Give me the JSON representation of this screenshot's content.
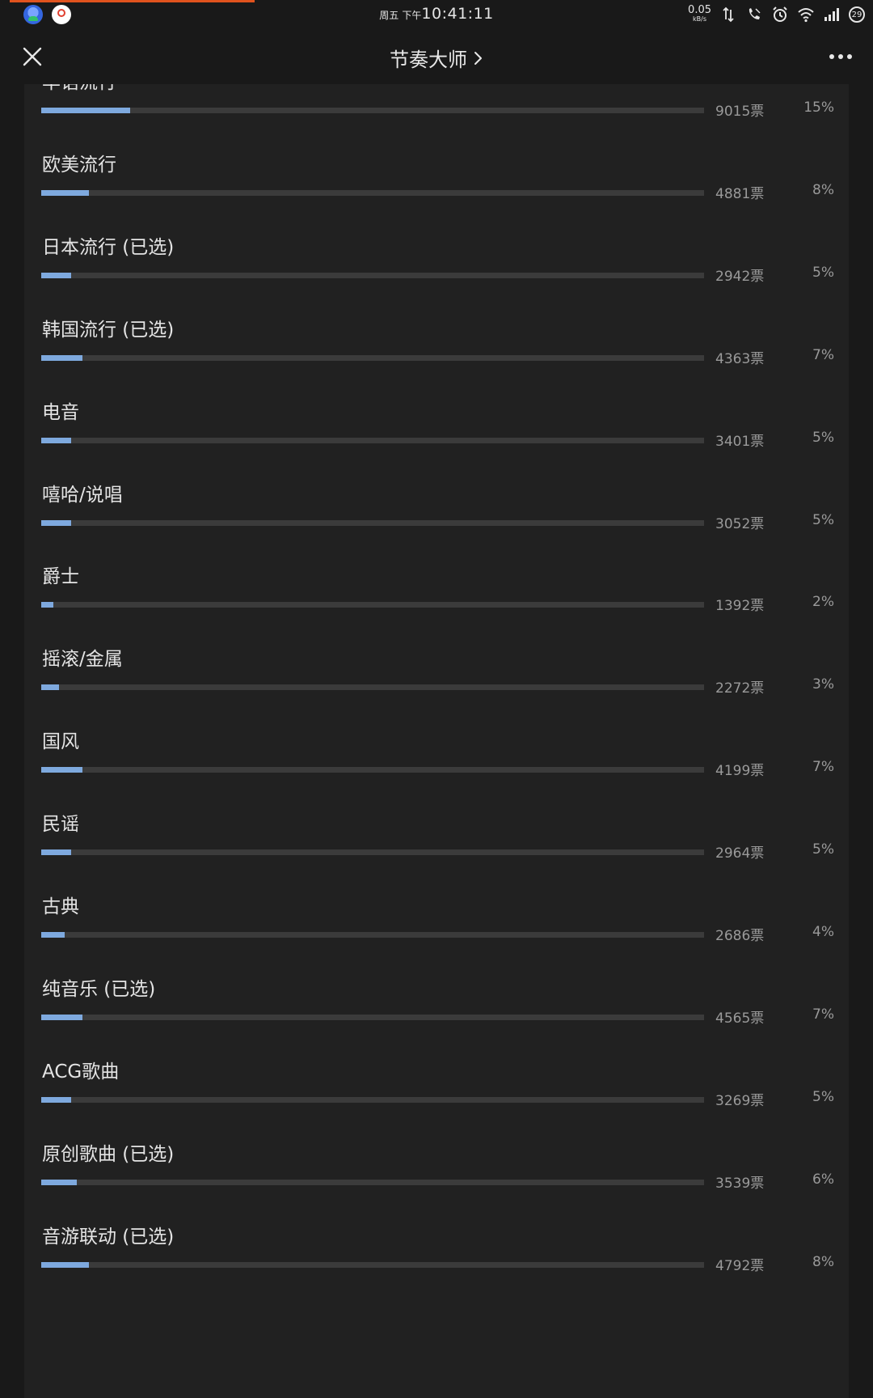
{
  "status_bar": {
    "weekday": "周五",
    "ampm": "下午",
    "time": "10:41:11",
    "net_speed": "0.05",
    "net_unit": "kB/s",
    "battery": "29"
  },
  "header": {
    "title": "节奏大师",
    "close_icon": "close-icon",
    "chevron_icon": "chevron-right-icon",
    "more_icon": "more-icon"
  },
  "colors": {
    "bar_fill": "#7ea9de",
    "bar_track": "#3b3b3b",
    "card_bg": "#212121",
    "page_bg": "#191919",
    "progress_strip": "#e0531e"
  },
  "poll": {
    "options": [
      {
        "label": "华语流行",
        "votes": "9015票",
        "percent": "15%",
        "fraction": 0.15
      },
      {
        "label": "欧美流行",
        "votes": "4881票",
        "percent": "8%",
        "fraction": 0.08
      },
      {
        "label": "日本流行 (已选)",
        "votes": "2942票",
        "percent": "5%",
        "fraction": 0.05
      },
      {
        "label": "韩国流行 (已选)",
        "votes": "4363票",
        "percent": "7%",
        "fraction": 0.07
      },
      {
        "label": "电音",
        "votes": "3401票",
        "percent": "5%",
        "fraction": 0.05
      },
      {
        "label": "嘻哈/说唱",
        "votes": "3052票",
        "percent": "5%",
        "fraction": 0.05
      },
      {
        "label": "爵士",
        "votes": "1392票",
        "percent": "2%",
        "fraction": 0.02
      },
      {
        "label": "摇滚/金属",
        "votes": "2272票",
        "percent": "3%",
        "fraction": 0.03
      },
      {
        "label": "国风",
        "votes": "4199票",
        "percent": "7%",
        "fraction": 0.07
      },
      {
        "label": "民谣",
        "votes": "2964票",
        "percent": "5%",
        "fraction": 0.05
      },
      {
        "label": "古典",
        "votes": "2686票",
        "percent": "4%",
        "fraction": 0.04
      },
      {
        "label": "纯音乐 (已选)",
        "votes": "4565票",
        "percent": "7%",
        "fraction": 0.07
      },
      {
        "label": "ACG歌曲",
        "votes": "3269票",
        "percent": "5%",
        "fraction": 0.05
      },
      {
        "label": "原创歌曲 (已选)",
        "votes": "3539票",
        "percent": "6%",
        "fraction": 0.06
      },
      {
        "label": "音游联动 (已选)",
        "votes": "4792票",
        "percent": "8%",
        "fraction": 0.08
      }
    ]
  }
}
